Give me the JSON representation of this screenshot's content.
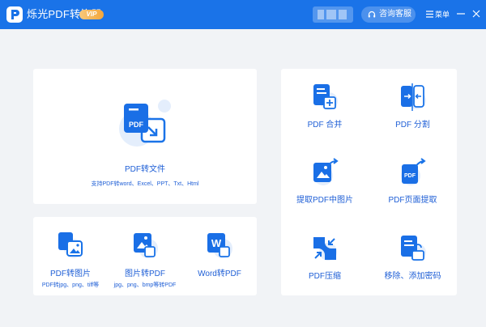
{
  "app": {
    "title": "烁光PDF转换器",
    "vip_badge": "VIP",
    "customer_service_label": "咨询客服",
    "menu_label": "菜单"
  },
  "colors": {
    "titlebar": "#1a73e8",
    "accent": "#1f5fd6",
    "background": "#f1f3f6",
    "vip": "#f3a63a"
  },
  "main_feature": {
    "label": "PDF转文件",
    "description": "支持PDF转word、Excel、PPT、Txt、Html",
    "icon": "pdf-convert-icon"
  },
  "bottom_tools": [
    {
      "label": "PDF转图片",
      "description": "PDF转jpg、png、tiff等",
      "icon": "pdf-to-image-icon"
    },
    {
      "label": "图片转PDF",
      "description": "jpg、png、bmp等转PDF",
      "icon": "image-to-pdf-icon"
    },
    {
      "label": "Word转PDF",
      "description": "",
      "icon": "word-to-pdf-icon"
    }
  ],
  "right_tools": [
    {
      "label": "PDF 合并",
      "icon": "merge-icon"
    },
    {
      "label": "PDF 分割",
      "icon": "split-icon"
    },
    {
      "label": "提取PDF中图片",
      "icon": "extract-image-icon"
    },
    {
      "label": "PDF页面提取",
      "icon": "extract-page-icon"
    },
    {
      "label": "PDF压缩",
      "icon": "compress-icon"
    },
    {
      "label": "移除、添加密码",
      "icon": "password-icon"
    }
  ]
}
